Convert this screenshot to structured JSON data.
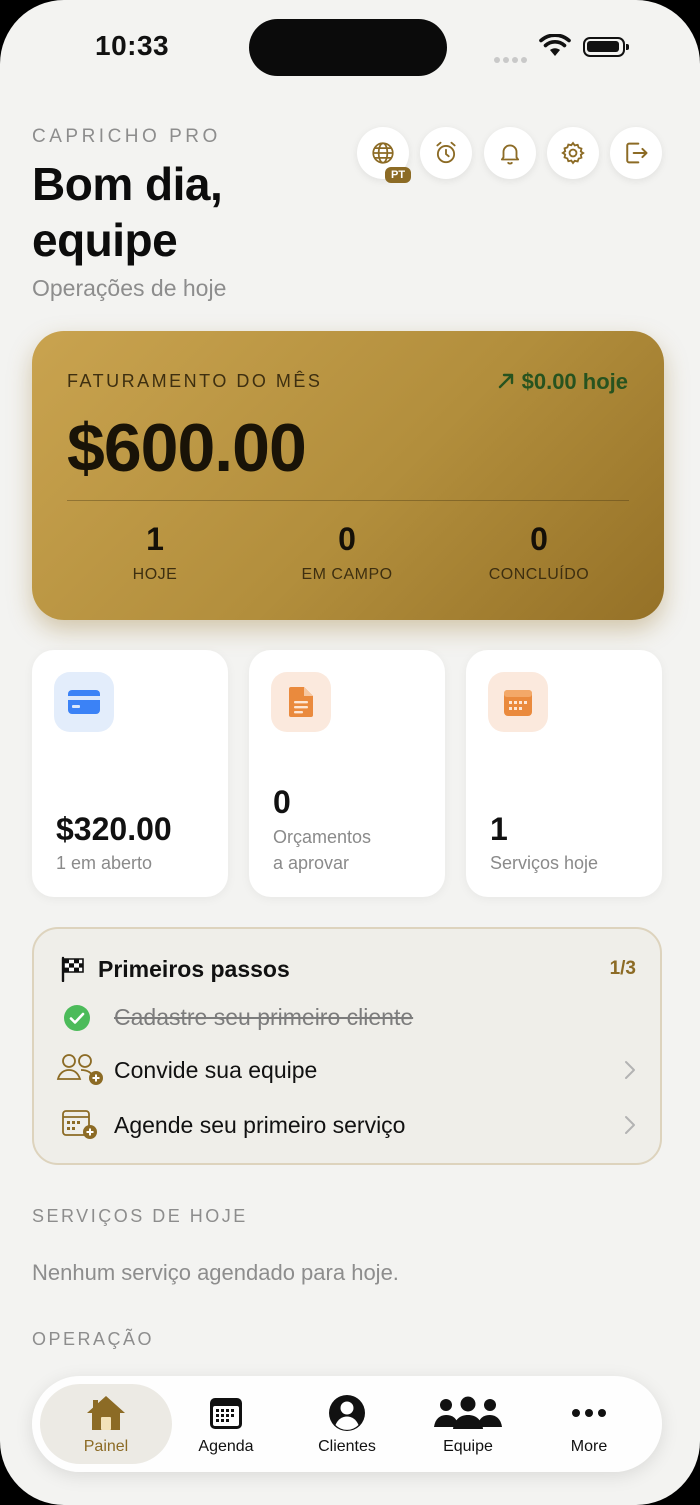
{
  "status_bar": {
    "time": "10:33"
  },
  "header": {
    "brand": "CAPRICHO PRO",
    "greeting": "Bom dia, equipe",
    "subtitle": "Operações de hoje",
    "language_badge": "PT",
    "actions": [
      "globe-icon",
      "alarm-icon",
      "bell-icon",
      "gear-icon",
      "logout-icon"
    ]
  },
  "revenue": {
    "label": "FATURAMENTO DO MÊS",
    "today": "$0.00 hoje",
    "amount": "$600.00",
    "stats": [
      {
        "value": "1",
        "label": "HOJE"
      },
      {
        "value": "0",
        "label": "EM CAMPO"
      },
      {
        "value": "0",
        "label": "CONCLUÍDO"
      }
    ]
  },
  "cards": [
    {
      "icon": "credit-card-icon",
      "value": "$320.00",
      "label": "1 em aberto",
      "icon_color": "#3b82f6",
      "bg": "#e3edfb"
    },
    {
      "icon": "document-icon",
      "value": "0",
      "label_line1": "Orçamentos",
      "label_line2": "a aprovar",
      "icon_color": "#ea8a3d",
      "bg": "#fbe9dd"
    },
    {
      "icon": "calendar-icon",
      "value": "1",
      "label": "Serviços hoje",
      "icon_color": "#ea8a3d",
      "bg": "#fbe9dd"
    }
  ],
  "onboarding": {
    "title": "Primeiros passos",
    "progress": "1/3",
    "steps": [
      {
        "label": "Cadastre seu primeiro cliente",
        "done": true
      },
      {
        "label": "Convide sua equipe",
        "done": false
      },
      {
        "label": "Agende seu primeiro serviço",
        "done": false
      }
    ]
  },
  "today_services": {
    "heading": "SERVIÇOS DE HOJE",
    "empty": "Nenhum serviço agendado para hoje."
  },
  "operation": {
    "heading": "OPERAÇÃO"
  },
  "tabbar": {
    "items": [
      {
        "label": "Painel",
        "icon": "house-icon",
        "selected": true
      },
      {
        "label": "Agenda",
        "icon": "calendar-grid-icon"
      },
      {
        "label": "Clientes",
        "icon": "person-circle-icon"
      },
      {
        "label": "Equipe",
        "icon": "people-icon"
      },
      {
        "label": "More",
        "icon": "more-icon"
      }
    ]
  },
  "colors": {
    "accent": "#8c6b25",
    "revenue_gradient_start": "#c9a34f",
    "revenue_gradient_end": "#957127",
    "positive": "#27531f",
    "success": "#4cbb5a"
  }
}
